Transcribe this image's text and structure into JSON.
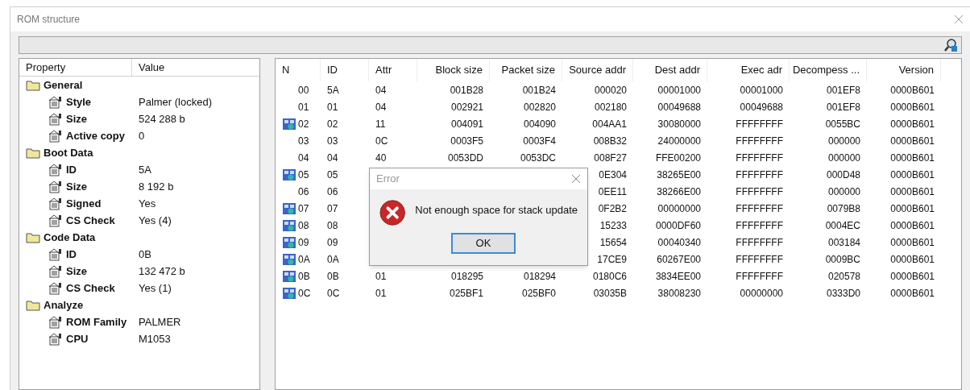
{
  "window": {
    "title": "ROM structure"
  },
  "property_tree": {
    "columns": [
      "Property",
      "Value"
    ],
    "groups": [
      {
        "label": "General",
        "children": [
          {
            "label": "Style",
            "value": "Palmer (locked)"
          },
          {
            "label": "Size",
            "value": "524 288 b"
          },
          {
            "label": "Active copy",
            "value": "0"
          }
        ]
      },
      {
        "label": "Boot Data",
        "children": [
          {
            "label": "ID",
            "value": "5A"
          },
          {
            "label": "Size",
            "value": "8 192 b"
          },
          {
            "label": "Signed",
            "value": "Yes"
          },
          {
            "label": "CS Check",
            "value": "Yes (4)"
          }
        ]
      },
      {
        "label": "Code Data",
        "children": [
          {
            "label": "ID",
            "value": "0B"
          },
          {
            "label": "Size",
            "value": "132 472 b"
          },
          {
            "label": "CS Check",
            "value": "Yes (1)"
          }
        ]
      },
      {
        "label": "Analyze",
        "children": [
          {
            "label": "ROM Family",
            "value": "PALMER"
          },
          {
            "label": "CPU",
            "value": "M1053"
          }
        ]
      }
    ]
  },
  "table": {
    "columns": [
      "N",
      "ID",
      "Attr",
      "Block size",
      "Packet size",
      "Source addr",
      "Dest addr",
      "Exec adr",
      "Decompess ...",
      "Version"
    ],
    "rows": [
      {
        "kind": "plain",
        "cells": [
          "00",
          "5A",
          "04",
          "001B28",
          "001B24",
          "000020",
          "00001000",
          "00001000",
          "001EF8",
          "0000B601"
        ]
      },
      {
        "kind": "plain",
        "cells": [
          "01",
          "01",
          "04",
          "002921",
          "002820",
          "002180",
          "00049688",
          "00049688",
          "001EF8",
          "0000B601"
        ]
      },
      {
        "kind": "block",
        "cells": [
          "02",
          "02",
          "11",
          "004091",
          "004090",
          "004AA1",
          "30080000",
          "FFFFFFFF",
          "0055BC",
          "0000B601"
        ]
      },
      {
        "kind": "plain",
        "cells": [
          "03",
          "03",
          "0C",
          "0003F5",
          "0003F4",
          "008B32",
          "24000000",
          "FFFFFFFF",
          "000000",
          "0000B601"
        ]
      },
      {
        "kind": "plain",
        "cells": [
          "04",
          "04",
          "40",
          "0053DD",
          "0053DC",
          "008F27",
          "FFE00200",
          "FFFFFFFF",
          "000000",
          "0000B601"
        ]
      },
      {
        "kind": "block",
        "cells": [
          "05",
          "05",
          "",
          "",
          "",
          "0E304",
          "38265E00",
          "FFFFFFFF",
          "000D48",
          "0000B601"
        ]
      },
      {
        "kind": "plain",
        "cells": [
          "06",
          "06",
          "",
          "",
          "",
          "0EE11",
          "38266E00",
          "FFFFFFFF",
          "000000",
          "0000B601"
        ]
      },
      {
        "kind": "block",
        "cells": [
          "07",
          "07",
          "",
          "",
          "",
          "0F2B2",
          "00000000",
          "FFFFFFFF",
          "0079B8",
          "0000B601"
        ]
      },
      {
        "kind": "block",
        "cells": [
          "08",
          "08",
          "",
          "",
          "",
          "15233",
          "0000DF60",
          "FFFFFFFF",
          "0004EC",
          "0000B601"
        ]
      },
      {
        "kind": "block",
        "cells": [
          "09",
          "09",
          "",
          "",
          "",
          "15654",
          "00040340",
          "FFFFFFFF",
          "003184",
          "0000B601"
        ]
      },
      {
        "kind": "block",
        "cells": [
          "0A",
          "0A",
          "",
          "",
          "",
          "17CE9",
          "60267E00",
          "FFFFFFFF",
          "0009BC",
          "0000B601"
        ]
      },
      {
        "kind": "block",
        "cells": [
          "0B",
          "0B",
          "01",
          "018295",
          "018294",
          "0180C6",
          "3834EE00",
          "FFFFFFFF",
          "020578",
          "0000B601"
        ]
      },
      {
        "kind": "block",
        "cells": [
          "0C",
          "0C",
          "01",
          "025BF1",
          "025BF0",
          "03035B",
          "38008230",
          "00000000",
          "0333D0",
          "0000B601"
        ]
      }
    ]
  },
  "dialog": {
    "title": "Error",
    "message": "Not enough space for stack update",
    "button": "OK"
  }
}
